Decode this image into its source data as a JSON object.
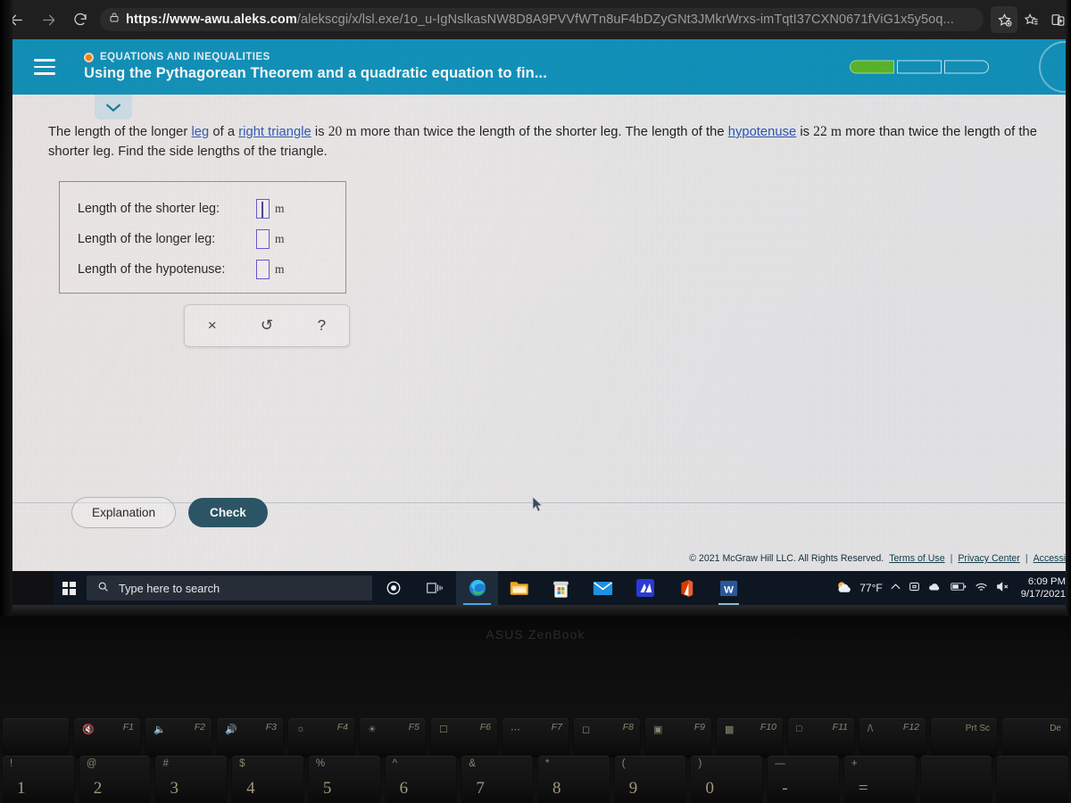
{
  "browser": {
    "back_icon": "back-arrow-icon",
    "forward_icon": "forward-arrow-icon",
    "reload_icon": "reload-icon",
    "lock_icon": "lock-icon",
    "url_bold": "https://www-awu.aleks.com",
    "url_rest": "/alekscgi/x/lsl.exe/1o_u-IgNslkasNW8D8A9PVVfWTn8uF4bDZyGNt3JMkrWrxs-imTqtI37CXN0671fViG1x5y5oq...",
    "favorite_icon": "add-favorite-star-icon",
    "collections_icon": "favorites-list-icon",
    "split_icon": "split-screen-icon"
  },
  "aleks": {
    "menu_icon": "hamburger-menu-icon",
    "topic_label": "EQUATIONS AND INEQUALITIES",
    "topic_dot": "orange-status-dot-icon",
    "lesson_title": "Using the Pythagorean Theorem and a quadratic equation to fin...",
    "progress": {
      "total": 3,
      "completed": 1,
      "fill_color": "#5cb82b"
    },
    "avatar": "profile-avatar",
    "chevron": "chevron-down-icon",
    "header_color": "#1294bd"
  },
  "question": {
    "part1": "The length of the longer ",
    "link1": "leg",
    "part2": " of a ",
    "link2": "right triangle",
    "part3": " is ",
    "num1": "20",
    "unit1": "m",
    "part4": " more than twice the length of the shorter leg. The length of the ",
    "link3": "hypotenuse",
    "part5": " is ",
    "num2": "22",
    "unit2": "m",
    "part6": " more than twice the length of the shorter leg. Find the side lengths of the triangle."
  },
  "answers": {
    "rows": [
      {
        "label": "Length of the shorter leg:",
        "value": "",
        "unit": "m",
        "active": true
      },
      {
        "label": "Length of the longer leg:",
        "value": "",
        "unit": "m",
        "active": false
      },
      {
        "label": "Length of the hypotenuse:",
        "value": "",
        "unit": "m",
        "active": false
      }
    ]
  },
  "toolbar": {
    "clear": "×",
    "clear_name": "clear-icon",
    "undo": "↺",
    "undo_name": "undo-icon",
    "help": "?",
    "help_name": "help-icon"
  },
  "actions": {
    "explanation_label": "Explanation",
    "check_label": "Check",
    "check_color": "#2c5767"
  },
  "legal": {
    "copyright": "© 2021 McGraw Hill LLC. All Rights Reserved.",
    "terms": "Terms of Use",
    "privacy": "Privacy Center",
    "accessibility": "Accessib",
    "separator": "|"
  },
  "taskbar": {
    "start_icon": "windows-start-icon",
    "search_placeholder": "Type here to search",
    "search_icon": "search-icon",
    "icons": [
      {
        "name": "cortana-icon",
        "glyph": "◎"
      },
      {
        "name": "task-view-icon",
        "glyph": ""
      },
      {
        "name": "microsoft-edge-icon",
        "glyph": ""
      },
      {
        "name": "file-explorer-icon",
        "glyph": ""
      },
      {
        "name": "microsoft-store-icon",
        "glyph": ""
      },
      {
        "name": "mail-icon",
        "glyph": ""
      },
      {
        "name": "myasus-icon",
        "glyph": ""
      },
      {
        "name": "microsoft-office-icon",
        "glyph": ""
      },
      {
        "name": "microsoft-word-icon",
        "glyph": "W"
      }
    ],
    "tray": {
      "weather_icon": "partly-cloudy-weather-icon",
      "temperature": "77°F",
      "chevron": "show-hidden-icons-chevron",
      "onedrive_icon": "onedrive-icon",
      "cloud_icon": "cloud-icon",
      "battery_icon": "battery-icon",
      "wifi_icon": "wifi-icon",
      "volume_icon": "volume-muted-icon",
      "time": "6:09 PM",
      "date": "9/17/2021"
    }
  },
  "laptop": {
    "brand": "ASUS ZenBook",
    "fn_keys": [
      {
        "label": "F1",
        "glyph": "mute-icon"
      },
      {
        "label": "F2",
        "glyph": "volume-down-icon"
      },
      {
        "label": "F3",
        "glyph": "volume-up-icon"
      },
      {
        "label": "F4",
        "glyph": "brightness-down-icon"
      },
      {
        "label": "F5",
        "glyph": "brightness-up-icon"
      },
      {
        "label": "F6",
        "glyph": "display-switch-icon"
      },
      {
        "label": "F7",
        "glyph": "keyboard-backlight-icon"
      },
      {
        "label": "F8",
        "glyph": "project-screen-icon"
      },
      {
        "label": "F9",
        "glyph": "lock-screen-icon"
      },
      {
        "label": "F10",
        "glyph": "camera-off-icon"
      },
      {
        "label": "F11",
        "glyph": "screenshot-icon"
      },
      {
        "label": "F12",
        "glyph": "myasus-key-icon"
      },
      {
        "label": "Prt Sc",
        "glyph": ""
      },
      {
        "label": "De",
        "glyph": ""
      }
    ],
    "num_keys": [
      {
        "sym": "!",
        "num": "1"
      },
      {
        "sym": "@",
        "num": "2"
      },
      {
        "sym": "#",
        "num": "3"
      },
      {
        "sym": "$",
        "num": "4"
      },
      {
        "sym": "%",
        "num": "5"
      },
      {
        "sym": "^",
        "num": "6"
      },
      {
        "sym": "&",
        "num": "7"
      },
      {
        "sym": "*",
        "num": "8"
      },
      {
        "sym": "(",
        "num": "9"
      },
      {
        "sym": ")",
        "num": "0"
      },
      {
        "sym": "—",
        "num": "-"
      },
      {
        "sym": "+",
        "num": "="
      },
      {
        "sym": "",
        "num": ""
      },
      {
        "sym": "",
        "num": ""
      }
    ]
  }
}
